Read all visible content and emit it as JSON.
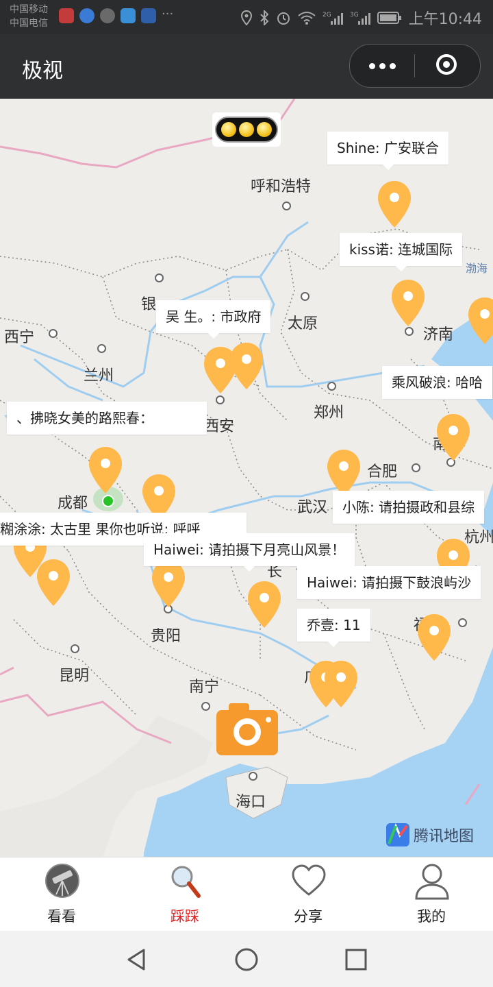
{
  "status_bar": {
    "carrier_1": "中国移动",
    "carrier_2": "中国电信",
    "time": "上午10:44",
    "icons": [
      "location-icon",
      "bluetooth-icon",
      "alarm-icon",
      "wifi-icon",
      "signal-2g-icon",
      "signal-3g-icon",
      "battery-icon"
    ]
  },
  "header": {
    "title": "极视",
    "more_icon": "more-dots-icon",
    "close_icon": "target-close-icon"
  },
  "map": {
    "cities": [
      {
        "name": "呼和浩特"
      },
      {
        "name": "太原"
      },
      {
        "name": "济南"
      },
      {
        "name": "西宁"
      },
      {
        "name": "兰州"
      },
      {
        "name": "银"
      },
      {
        "name": "郑州"
      },
      {
        "name": "西安"
      },
      {
        "name": "合肥"
      },
      {
        "name": "成都"
      },
      {
        "name": "武汉"
      },
      {
        "name": "杭州"
      },
      {
        "name": "贵阳"
      },
      {
        "name": "昆明"
      },
      {
        "name": "南宁"
      },
      {
        "name": "海口"
      },
      {
        "name": "南"
      },
      {
        "name": "福"
      },
      {
        "name": "长"
      },
      {
        "name": "广"
      }
    ],
    "sea_label": "渤海",
    "callouts": [
      {
        "text": "Shine: 广安联合"
      },
      {
        "text": "kiss诺: 连城国际"
      },
      {
        "text": "吴 生。: 市政府"
      },
      {
        "text": "乘风破浪: 哈哈"
      },
      {
        "text": "、拂晓女美的路熙春："
      },
      {
        "text": "小陈: 请拍摄政和县综"
      },
      {
        "text": "糊涂涂: 太古里  果你也听说: 呼呼"
      },
      {
        "text": "Haiwei: 请拍摄下月亮山风景！"
      },
      {
        "text": "Haiwei: 请拍摄下鼓浪屿沙"
      },
      {
        "text": "乔壹: 11"
      }
    ],
    "pin_color": "#ffb84a",
    "traffic_icon": "traffic-light-icon",
    "camera_icon": "camera-icon",
    "logo_text": "腾讯地图"
  },
  "tabbar": {
    "tabs": [
      {
        "label": "看看",
        "icon": "telescope-icon",
        "active": false
      },
      {
        "label": "踩踩",
        "icon": "magnifier-icon",
        "active": true
      },
      {
        "label": "分享",
        "icon": "heart-icon",
        "active": false
      },
      {
        "label": "我的",
        "icon": "user-icon",
        "active": false
      }
    ],
    "active_color": "#e02020"
  },
  "navbar": {
    "buttons": [
      "back-icon",
      "home-icon",
      "recents-icon"
    ]
  }
}
